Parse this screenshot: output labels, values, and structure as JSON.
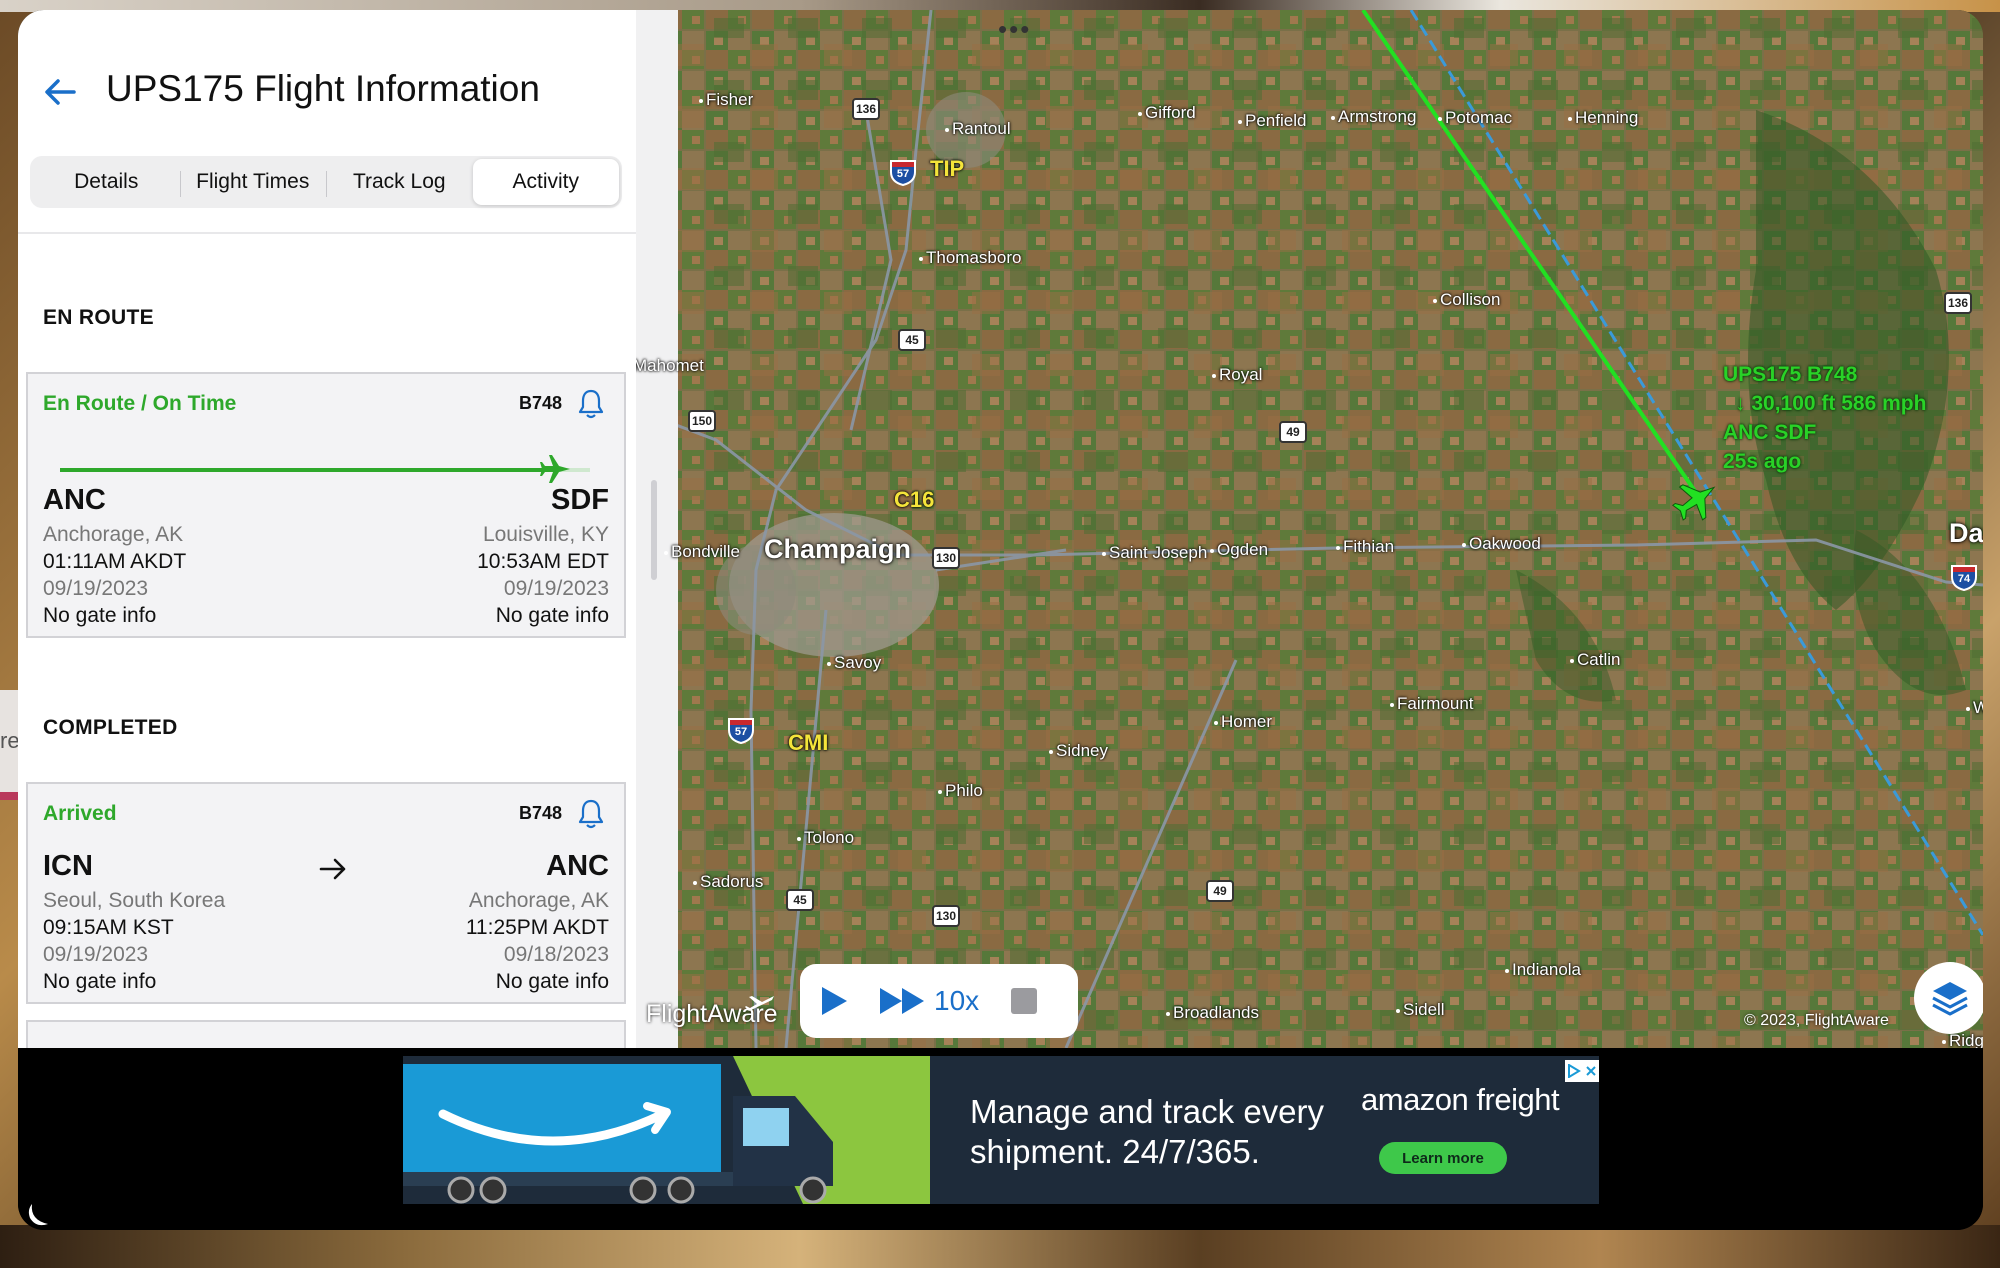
{
  "header": {
    "title": "UPS175 Flight Information"
  },
  "tabs": [
    {
      "label": "Details",
      "active": false
    },
    {
      "label": "Flight Times",
      "active": false
    },
    {
      "label": "Track Log",
      "active": false
    },
    {
      "label": "Activity",
      "active": true
    }
  ],
  "sections": {
    "en_route": "EN ROUTE",
    "completed": "COMPLETED"
  },
  "flights": [
    {
      "status": "En Route / On Time",
      "aircraft": "B748",
      "progress_fraction": 0.93,
      "origin": {
        "code": "ANC",
        "city": "Anchorage, AK",
        "time": "01:11AM AKDT",
        "date": "09/19/2023",
        "gate": "No gate info"
      },
      "destination": {
        "code": "SDF",
        "city": "Louisville, KY",
        "time": "10:53AM EDT",
        "date": "09/19/2023",
        "gate": "No gate info"
      }
    },
    {
      "status": "Arrived",
      "aircraft": "B748",
      "origin": {
        "code": "ICN",
        "city": "Seoul, South Korea",
        "time": "09:15AM KST",
        "date": "09/19/2023",
        "gate": "No gate info"
      },
      "destination": {
        "code": "ANC",
        "city": "Anchorage, AK",
        "time": "11:25PM AKDT",
        "date": "09/18/2023",
        "gate": "No gate info"
      }
    }
  ],
  "map": {
    "towns": [
      "Fisher",
      "Rantoul",
      "Gifford",
      "Penfield",
      "Armstrong",
      "Potomac",
      "Henning",
      "Thomasboro",
      "Collison",
      "Mahomet",
      "Royal",
      "Bondville",
      "Saint Joseph",
      "Ogden",
      "Fithian",
      "Oakwood",
      "Savoy",
      "Catlin",
      "Fairmount",
      "Homer",
      "Sidney",
      "Philo",
      "Tolono",
      "Sadorus",
      "Indianola",
      "Broadlands",
      "Sidell"
    ],
    "city": "Champaign",
    "edge_labels": {
      "danville": "Danv",
      "ridge": "Ridg",
      "w": "W"
    },
    "airports": [
      "TIP",
      "C16",
      "CMI"
    ],
    "shields": [
      "136",
      "150",
      "45",
      "130",
      "49",
      "49",
      "130",
      "45",
      "136"
    ],
    "interstates": [
      "57",
      "57",
      "74"
    ],
    "flight_label": {
      "line1": "UPS175 B748",
      "line2": "↓ 30,100 ft 586 mph",
      "line3": "ANC SDF",
      "line4": "25s ago"
    },
    "brand": "FlightAware",
    "copyright": "© 2023, FlightAware",
    "playback": {
      "speed": "10x"
    },
    "colors": {
      "track": "#22e022",
      "planned_route": "#3a9ad9"
    }
  },
  "ad": {
    "headline_line1": "Manage and track every",
    "headline_line2": "shipment. 24/7/365.",
    "brand_word1": "amazon",
    "brand_word2": "freight",
    "cta": "Learn more"
  },
  "colors": {
    "accent_green": "#2ea82b",
    "ios_blue": "#1a6fc9"
  }
}
